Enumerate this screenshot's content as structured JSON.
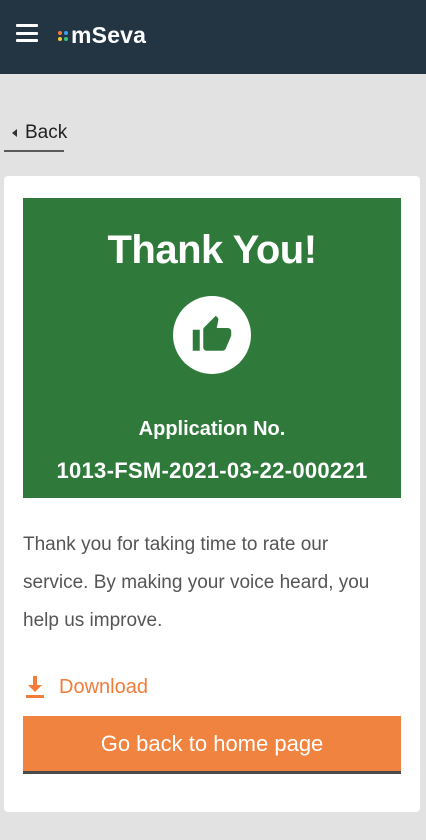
{
  "header": {
    "app_name": "mSeva",
    "menu_icon": "hamburger-icon",
    "logo_dot_colors": [
      "#f27c3a",
      "#3aa0f2",
      "#f2c83a",
      "#3ac27a"
    ],
    "background": "#233443"
  },
  "back": {
    "label": "Back",
    "icon": "chevron-left-icon"
  },
  "banner": {
    "title": "Thank You!",
    "icon": "thumbs-up-icon",
    "application_label": "Application No.",
    "application_number": "1013-FSM-2021-03-22-000221",
    "color": "#2f7a3b"
  },
  "message": "Thank you for taking time to rate our service. By making your voice heard, you help us improve.",
  "download": {
    "label": "Download",
    "icon": "download-icon",
    "color": "#f27c3a"
  },
  "home_button": {
    "label": "Go back to home page",
    "color": "#f0833f"
  }
}
